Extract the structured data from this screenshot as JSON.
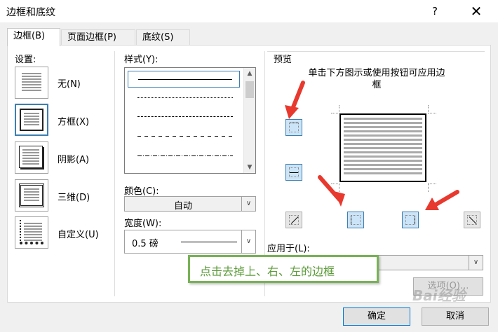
{
  "window": {
    "title": "边框和底纹",
    "help_label": "?",
    "close_label": "✕"
  },
  "tabs": [
    {
      "label": "边框(B)",
      "active": true
    },
    {
      "label": "页面边框(P)",
      "active": false
    },
    {
      "label": "底纹(S)",
      "active": false
    }
  ],
  "settings": {
    "label": "设置:",
    "items": [
      {
        "label": "无(N)"
      },
      {
        "label": "方框(X)",
        "selected": true
      },
      {
        "label": "阴影(A)"
      },
      {
        "label": "三维(D)"
      },
      {
        "label": "自定义(U)"
      }
    ]
  },
  "style": {
    "label": "样式(Y):",
    "items": [
      "solid",
      "dotted",
      "dashed-short",
      "dashed",
      "dash-dot"
    ],
    "selected_index": 0
  },
  "color": {
    "label": "颜色(C):",
    "value": "自动"
  },
  "width": {
    "label": "宽度(W):",
    "value": "0.5 磅"
  },
  "preview": {
    "label": "预览",
    "hint": "单击下方图示或使用按钮可应用边框"
  },
  "apply_to": {
    "label": "应用于(L):",
    "value": ""
  },
  "buttons": {
    "options": "选项(O)...",
    "ok": "确定",
    "cancel": "取消"
  },
  "annotation": {
    "text": "点击去掉上、右、左的边框"
  },
  "watermark": {
    "text": "Bai经验"
  },
  "colors": {
    "accent": "#3c7fb1",
    "arrow": "#e8392e",
    "callout": "#77b255"
  }
}
